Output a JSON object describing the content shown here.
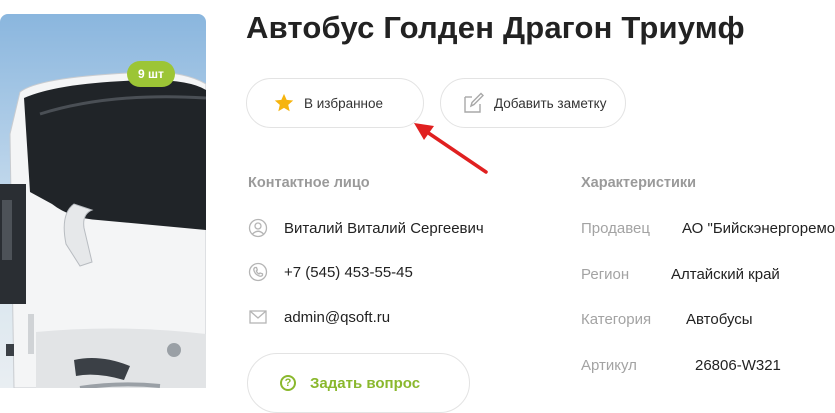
{
  "product": {
    "title": "Автобус Голден Драгон Триумф",
    "photo_count_badge": "9 шт"
  },
  "actions": {
    "favorite_label": "В избранное",
    "note_label": "Добавить заметку",
    "ask_label": "Задать вопрос"
  },
  "contact": {
    "heading": "Контактное лицо",
    "name": "Виталий Виталий Сергеевич",
    "phone": "+7 (545) 453-55-45",
    "email": "admin@qsoft.ru"
  },
  "specs": {
    "heading": "Характеристики",
    "rows": [
      {
        "key": "Продавец",
        "value": "АО \"Бийскэнергоремонт\""
      },
      {
        "key": "Регион",
        "value": "Алтайский край"
      },
      {
        "key": "Категория",
        "value": "Автобусы"
      },
      {
        "key": "Артикул",
        "value": "26806-W321"
      }
    ]
  },
  "colors": {
    "accent_green": "#9cc536",
    "star_yellow": "#f6b40e",
    "arrow_red": "#e02020",
    "muted_gray": "#a3a3a3"
  },
  "icons": {
    "favorite": "star-icon",
    "note": "pencil-note-icon",
    "contact_name": "user-icon",
    "contact_phone": "phone-icon",
    "contact_email": "envelope-icon",
    "ask": "question-circle-icon",
    "annotation": "red-arrow-icon"
  }
}
